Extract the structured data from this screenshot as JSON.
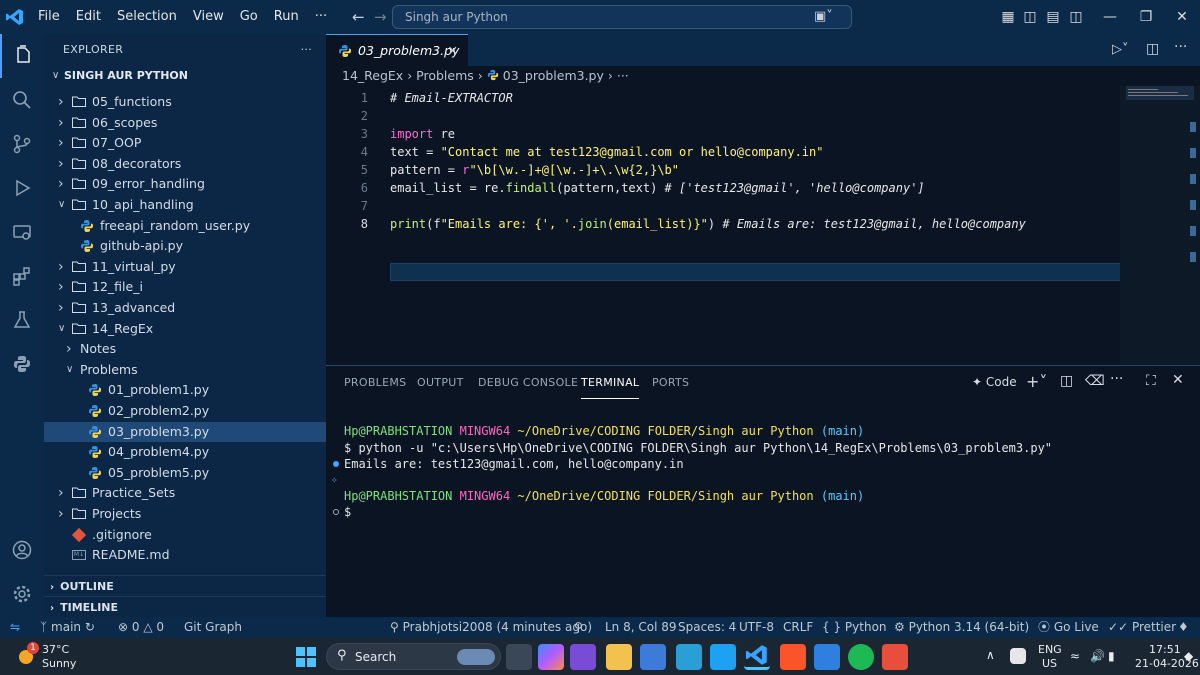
{
  "titlebar": {
    "menu": [
      "File",
      "Edit",
      "Selection",
      "View",
      "Go",
      "Run",
      "···"
    ],
    "search": "Singh aur Python"
  },
  "explorer": {
    "title": "EXPLORER",
    "more": "···",
    "root": "SINGH AUR PYTHON",
    "items": [
      {
        "label": "05_functions",
        "kind": "folder",
        "state": "closed",
        "depth": 1
      },
      {
        "label": "06_scopes",
        "kind": "folder",
        "state": "closed",
        "depth": 1
      },
      {
        "label": "07_OOP",
        "kind": "folder",
        "state": "closed",
        "depth": 1
      },
      {
        "label": "08_decorators",
        "kind": "folder",
        "state": "closed",
        "depth": 1
      },
      {
        "label": "09_error_handling",
        "kind": "folder",
        "state": "closed",
        "depth": 1
      },
      {
        "label": "10_api_handling",
        "kind": "folder",
        "state": "open",
        "depth": 1
      },
      {
        "label": "freeapi_random_user.py",
        "kind": "python",
        "depth": 2
      },
      {
        "label": "github-api.py",
        "kind": "python",
        "depth": 2
      },
      {
        "label": "11_virtual_py",
        "kind": "folder",
        "state": "closed",
        "depth": 1
      },
      {
        "label": "12_file_i",
        "kind": "folder",
        "state": "closed",
        "depth": 1
      },
      {
        "label": "13_advanced",
        "kind": "folder",
        "state": "closed",
        "depth": 1
      },
      {
        "label": "14_RegEx",
        "kind": "folder",
        "state": "open",
        "depth": 1
      },
      {
        "label": "Notes",
        "kind": "subfolder",
        "state": "closed",
        "depth": 2
      },
      {
        "label": "Problems",
        "kind": "subfolder",
        "state": "open",
        "depth": 2
      },
      {
        "label": "01_problem1.py",
        "kind": "python",
        "depth": 3
      },
      {
        "label": "02_problem2.py",
        "kind": "python",
        "depth": 3
      },
      {
        "label": "03_problem3.py",
        "kind": "python",
        "depth": 3,
        "selected": true
      },
      {
        "label": "04_problem4.py",
        "kind": "python",
        "depth": 3
      },
      {
        "label": "05_problem5.py",
        "kind": "python",
        "depth": 3
      },
      {
        "label": "Practice_Sets",
        "kind": "folder",
        "state": "closed",
        "depth": 1
      },
      {
        "label": "Projects",
        "kind": "folder",
        "state": "closed",
        "depth": 1
      },
      {
        "label": ".gitignore",
        "kind": "git",
        "depth": 1
      },
      {
        "label": "README.md",
        "kind": "md",
        "depth": 1
      }
    ],
    "outline": "OUTLINE",
    "timeline": "TIMELINE"
  },
  "editor": {
    "tab": "03_problem3.py",
    "breadcrumb": [
      "14_RegEx",
      "Problems",
      "03_problem3.py",
      "···"
    ],
    "lines": [
      {
        "n": "1",
        "text": "# Email-EXTRACTOR"
      },
      {
        "n": "2",
        "text": ""
      },
      {
        "n": "3",
        "text": "import re"
      },
      {
        "n": "4",
        "text": "text = \"Contact me at test123@gmail.com or hello@company.in\""
      },
      {
        "n": "5",
        "text": "pattern = r\"\\b[\\w.-]+@[\\w.-]+\\.\\w{2,}\\b\""
      },
      {
        "n": "6",
        "text": "email_list = re.findall(pattern,text) # ['test123@gmail', 'hello@company']"
      },
      {
        "n": "7",
        "text": ""
      },
      {
        "n": "8",
        "text": "print(f\"Emails are: {', '.join(email_list)}\") # Emails are: test123@gmail, hello@company"
      }
    ]
  },
  "panel": {
    "tabs": [
      "PROBLEMS",
      "OUTPUT",
      "DEBUG CONSOLE",
      "TERMINAL",
      "PORTS"
    ],
    "active_tab": "TERMINAL",
    "code_label": "Code",
    "terminal": {
      "prompt_user": "Hp@PRABHSTATION",
      "prompt_shell": "MINGW64",
      "prompt_path": "~/OneDrive/CODING FOLDER/Singh aur Python",
      "prompt_branch": "(main)",
      "command": "$ python -u \"c:\\Users\\Hp\\OneDrive\\CODING FOLDER\\Singh aur Python\\14_RegEx\\Problems\\03_problem3.py\"",
      "output": "Emails are: test123@gmail.com, hello@company.in",
      "prompt2_user": "Hp@PRABHSTATION",
      "prompt2_shell": "MINGW64",
      "prompt2_path": "~/OneDrive/CODING FOLDER/Singh aur Python",
      "prompt2_branch": "(main)",
      "cursor": "$"
    }
  },
  "statusbar": {
    "branch": "main",
    "errors": "0",
    "warnings": "0",
    "git_graph": "Git Graph",
    "blame": "Prabhjotsi2008 (4 minutes ago)",
    "position": "Ln 8, Col 89",
    "spaces": "Spaces: 4",
    "encoding": "UTF-8",
    "eol": "CRLF",
    "language": "Python",
    "interpreter": "Python 3.14 (64-bit)",
    "golive": "Go Live",
    "prettier": "Prettier"
  },
  "taskbar": {
    "weather_temp": "37°C",
    "weather_desc": "Sunny",
    "weather_badge": "1",
    "search": "Search",
    "lang": "ENG",
    "region": "US",
    "time": "17:51",
    "date": "21-04-2026"
  },
  "colors": {
    "accent": "#4aa0ff",
    "keyword": "#ff6bd5",
    "string": "#fff27a",
    "function": "#c4f07b",
    "terminal_green": "#7ee07e",
    "terminal_magenta": "#ff66c4",
    "terminal_yellow": "#f1e05a",
    "terminal_cyan": "#5cc8ff"
  }
}
